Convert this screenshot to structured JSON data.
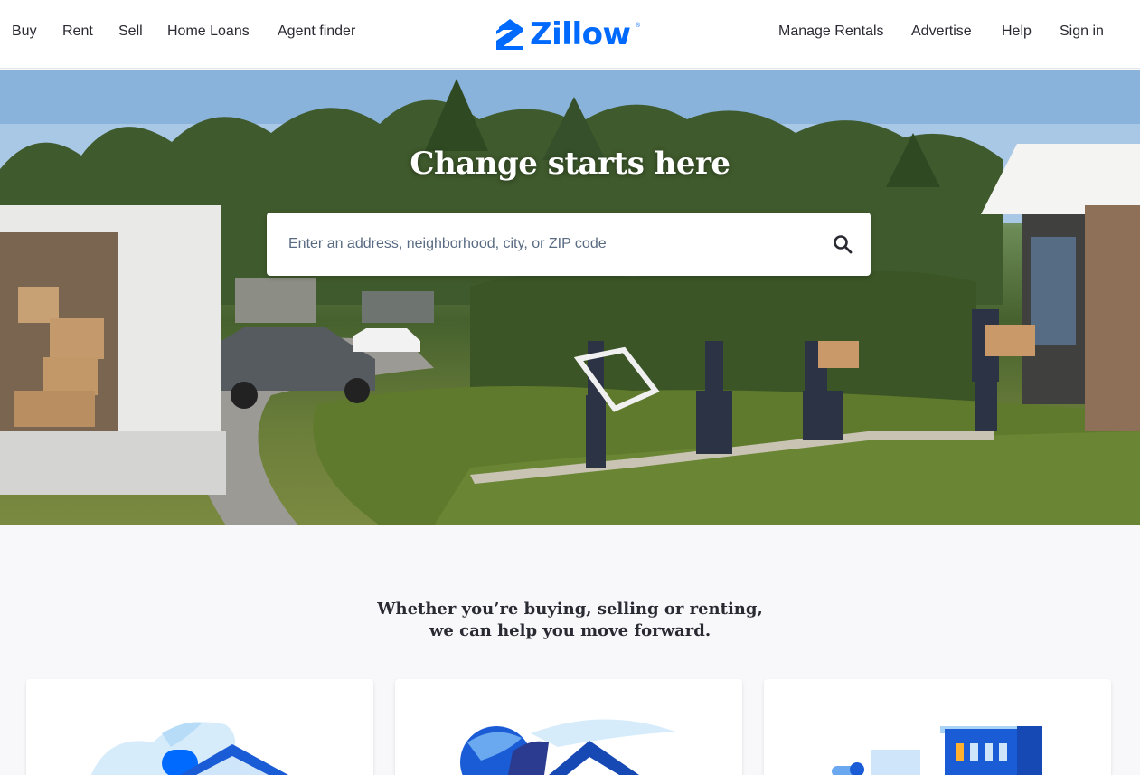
{
  "header": {
    "nav_left": [
      "Buy",
      "Rent",
      "Sell",
      "Home Loans",
      "Agent finder"
    ],
    "nav_right": [
      "Manage Rentals",
      "Advertise",
      "Help",
      "Sign in"
    ],
    "logo_text": "Zillow",
    "logo_mark": "®",
    "brand_color": "#006aff"
  },
  "hero": {
    "title": "Change starts here",
    "search": {
      "placeholder": "Enter an address, neighborhood, city, or ZIP code",
      "icon": "search-icon"
    }
  },
  "tagline": {
    "line1": "Whether you’re buying, selling or renting,",
    "line2": "we can help you move forward."
  },
  "cards": [
    {
      "illustration": "buy-house-illustration-icon"
    },
    {
      "illustration": "sell-house-illustration-icon"
    },
    {
      "illustration": "rent-building-illustration-icon"
    }
  ]
}
